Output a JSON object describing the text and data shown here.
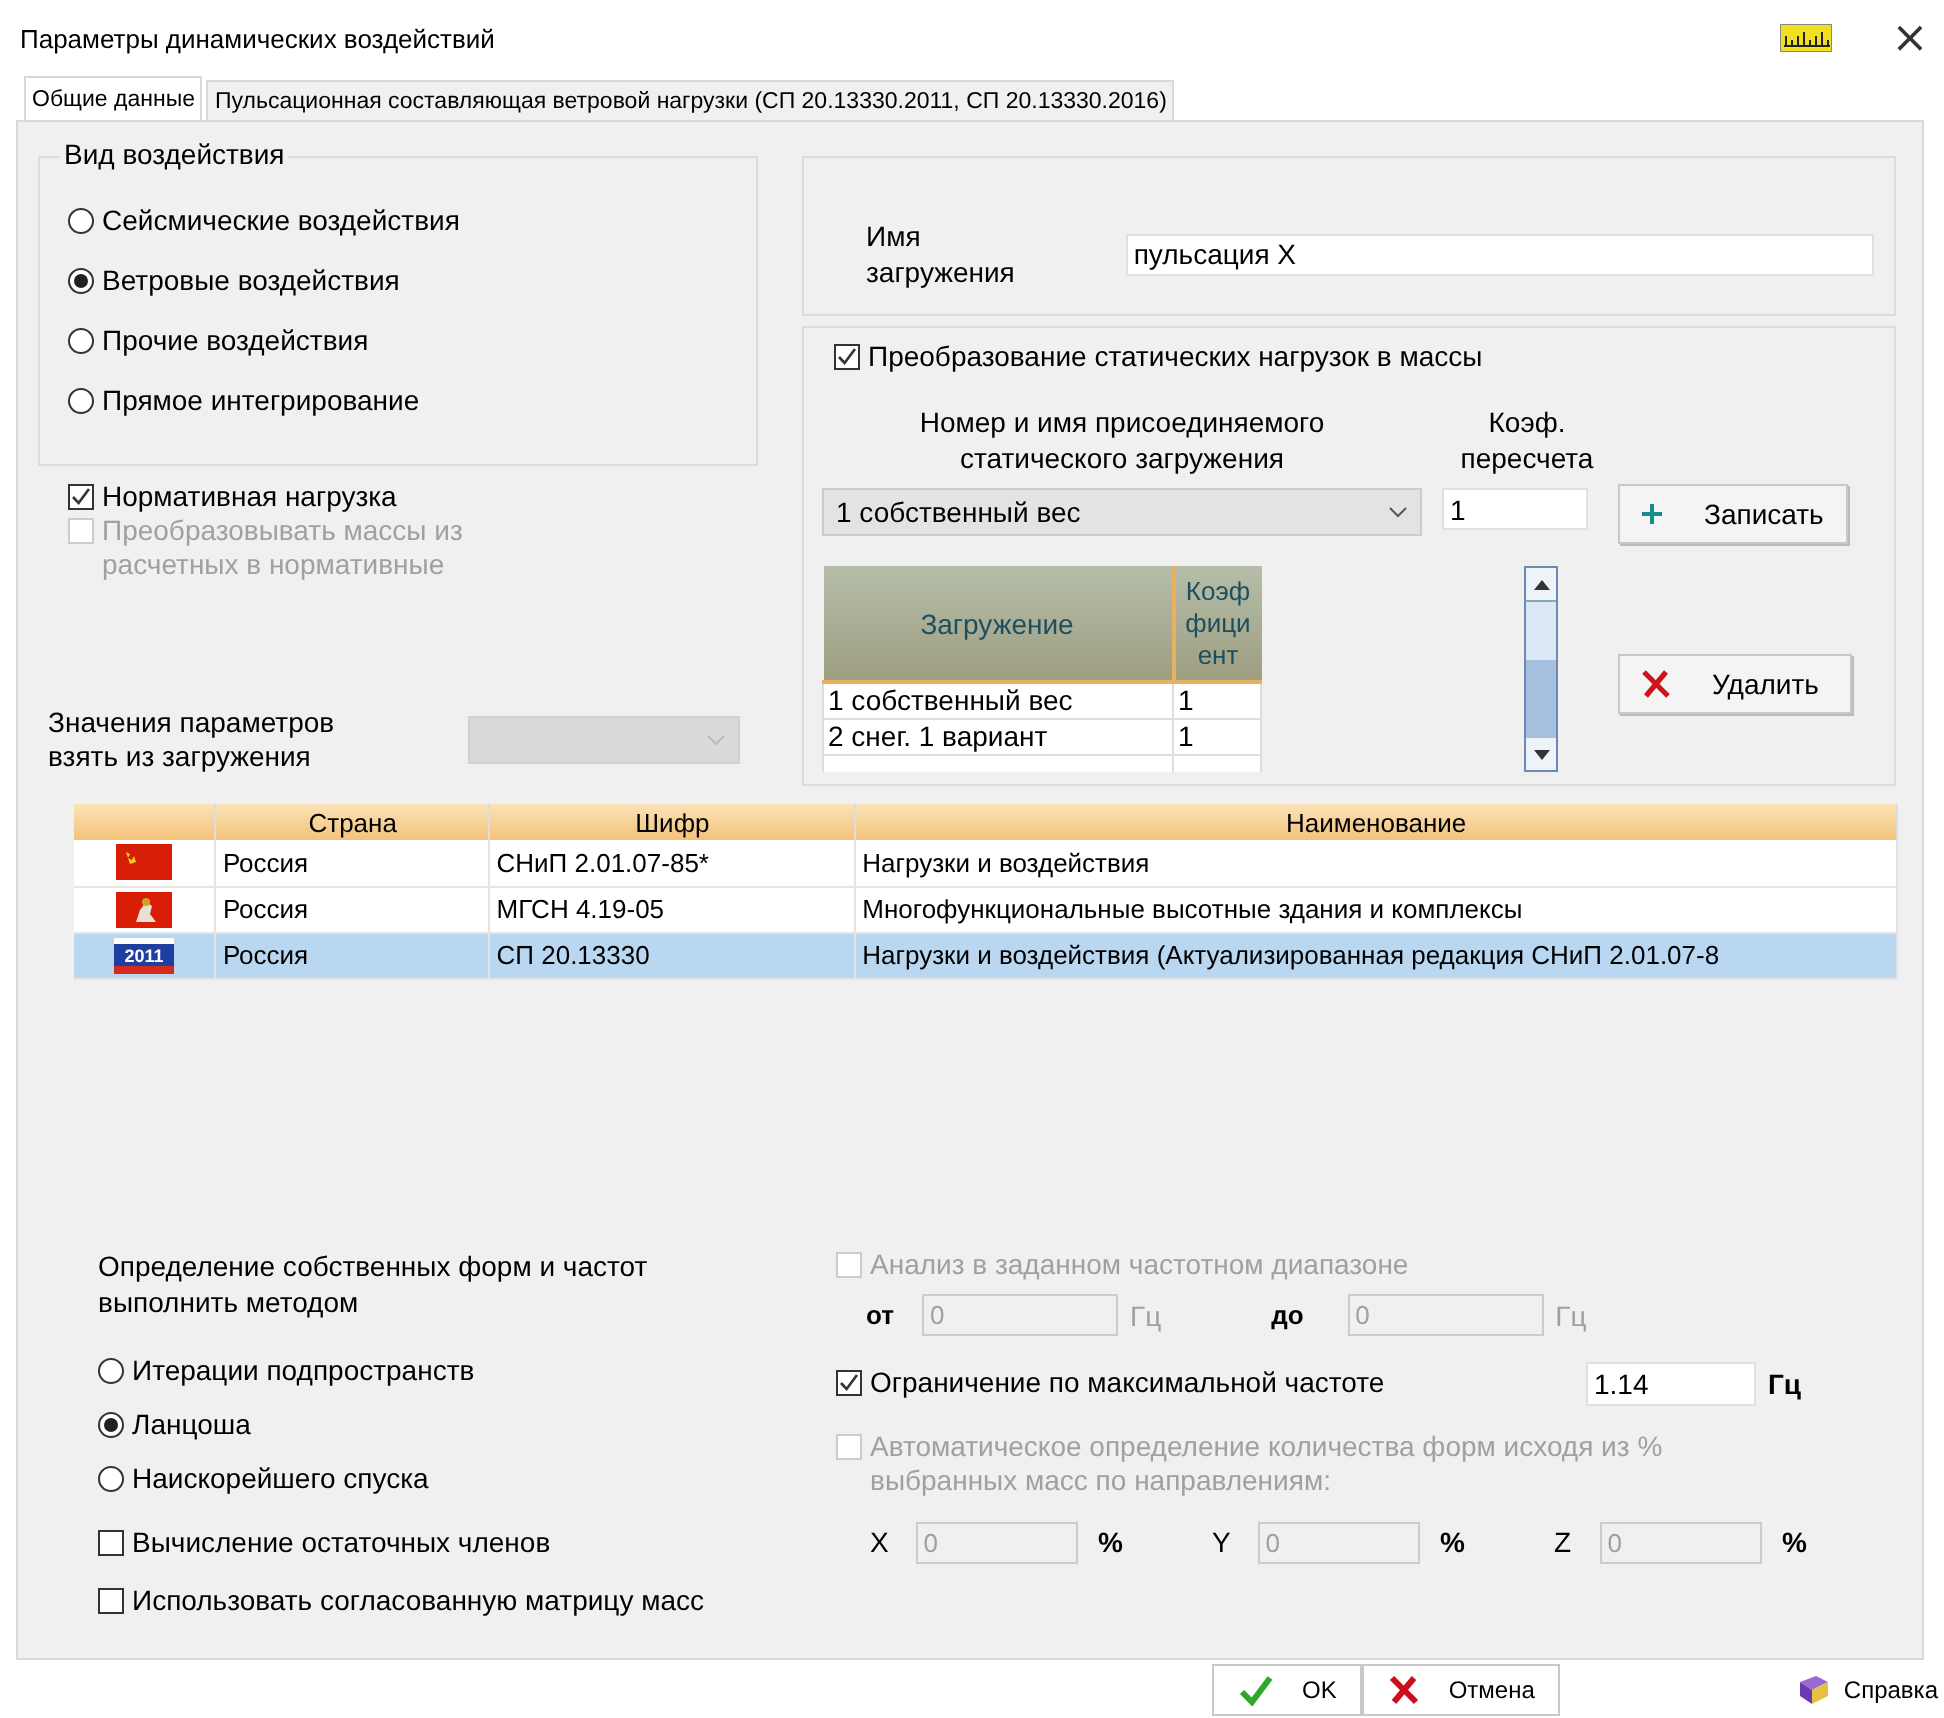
{
  "window": {
    "title": "Параметры динамических воздействий",
    "close": "×"
  },
  "tabs": [
    {
      "label": "Общие данные",
      "selected": true
    },
    {
      "label": "Пульсационная составляющая ветровой нагрузки (СП 20.13330.2011, СП 20.13330.2016)",
      "selected": false
    }
  ],
  "impact_type": {
    "title": "Вид воздействия",
    "options": [
      {
        "label": "Сейсмические воздействия",
        "selected": false
      },
      {
        "label": "Ветровые воздействия",
        "selected": true
      },
      {
        "label": "Прочие воздействия",
        "selected": false
      },
      {
        "label": "Прямое интегрирование",
        "selected": false
      }
    ]
  },
  "normative_load": {
    "label": "Нормативная нагрузка",
    "checked": true,
    "disabled": false
  },
  "convert_masses": {
    "label": "Преобразовывать массы из расчетных в нормативные",
    "checked": false,
    "disabled": true
  },
  "params_from": {
    "label": "Значения параметров взять из загружения",
    "disabled": true
  },
  "load_name": {
    "label": "Имя загружения",
    "value": "пульсация X"
  },
  "static_to_mass": {
    "label": "Преобразование статических нагрузок в массы",
    "checked": true,
    "load_select": {
      "label": "Номер и имя присоединяемого статического загружения",
      "value": "1 собственный вес"
    },
    "factor": {
      "label": "Коэф. пересчета",
      "value": "1"
    },
    "buttons": [
      {
        "label": "Записать",
        "kind": "add"
      },
      {
        "label": "Удалить",
        "kind": "delete"
      }
    ],
    "table": {
      "columns": [
        "Загружение",
        "Коэффициент"
      ],
      "rows": [
        [
          "1 собственный вес",
          "1"
        ],
        [
          "2 снег. 1 вариант",
          "1"
        ]
      ]
    }
  },
  "norms_table": {
    "columns": [
      "Страна",
      "Шифр",
      "Наименование"
    ],
    "rows": [
      {
        "kind": "ussr",
        "country": "Россия",
        "code": "СНиП 2.01.07-85*",
        "name": "Нагрузки и воздействия",
        "selected": false
      },
      {
        "kind": "moscow",
        "country": "Россия",
        "code": "МГСН 4.19-05",
        "name": "Многофункциональные высотные здания и комплексы",
        "selected": false
      },
      {
        "kind": "russia",
        "flag_text": "2011",
        "country": "Россия",
        "code": "СП 20.13330",
        "name": "Нагрузки и воздействия (Актуализированная редакция СНиП 2.01.07-8",
        "selected": true
      }
    ]
  },
  "method": {
    "title": "Определение собственных форм и частот выполнить методом",
    "options": [
      {
        "label": "Итерации подпространств",
        "selected": false
      },
      {
        "label": "Ланцоша",
        "selected": true
      },
      {
        "label": "Наискорейшего спуска",
        "selected": false
      }
    ]
  },
  "residual": {
    "label": "Вычисление остаточных членов",
    "checked": false
  },
  "consistent_mass": {
    "label": "Использовать согласованную матрицу масс",
    "checked": false
  },
  "freq_range": {
    "label": "Анализ в заданном частотном диапазоне",
    "checked": false,
    "disabled": true,
    "fields": [
      {
        "label": "от",
        "value": "0",
        "unit": "Гц"
      },
      {
        "label": "до",
        "value": "0",
        "unit": "Гц"
      }
    ]
  },
  "max_freq": {
    "label": "Ограничение по максимальной частоте",
    "checked": true,
    "value": "1.14",
    "unit": "Гц"
  },
  "auto_modes": {
    "label": "Автоматическое определение количества форм исходя из % выбранных масс по направлениям:",
    "checked": false,
    "disabled": true,
    "fields": [
      {
        "label": "X",
        "value": "0",
        "unit": "%"
      },
      {
        "label": "Y",
        "value": "0",
        "unit": "%"
      },
      {
        "label": "Z",
        "value": "0",
        "unit": "%"
      }
    ]
  },
  "footer": {
    "buttons": [
      {
        "label": "OK",
        "kind": "ok"
      },
      {
        "label": "Отмена",
        "kind": "cancel"
      },
      {
        "label": "Справка",
        "kind": "help"
      }
    ]
  }
}
